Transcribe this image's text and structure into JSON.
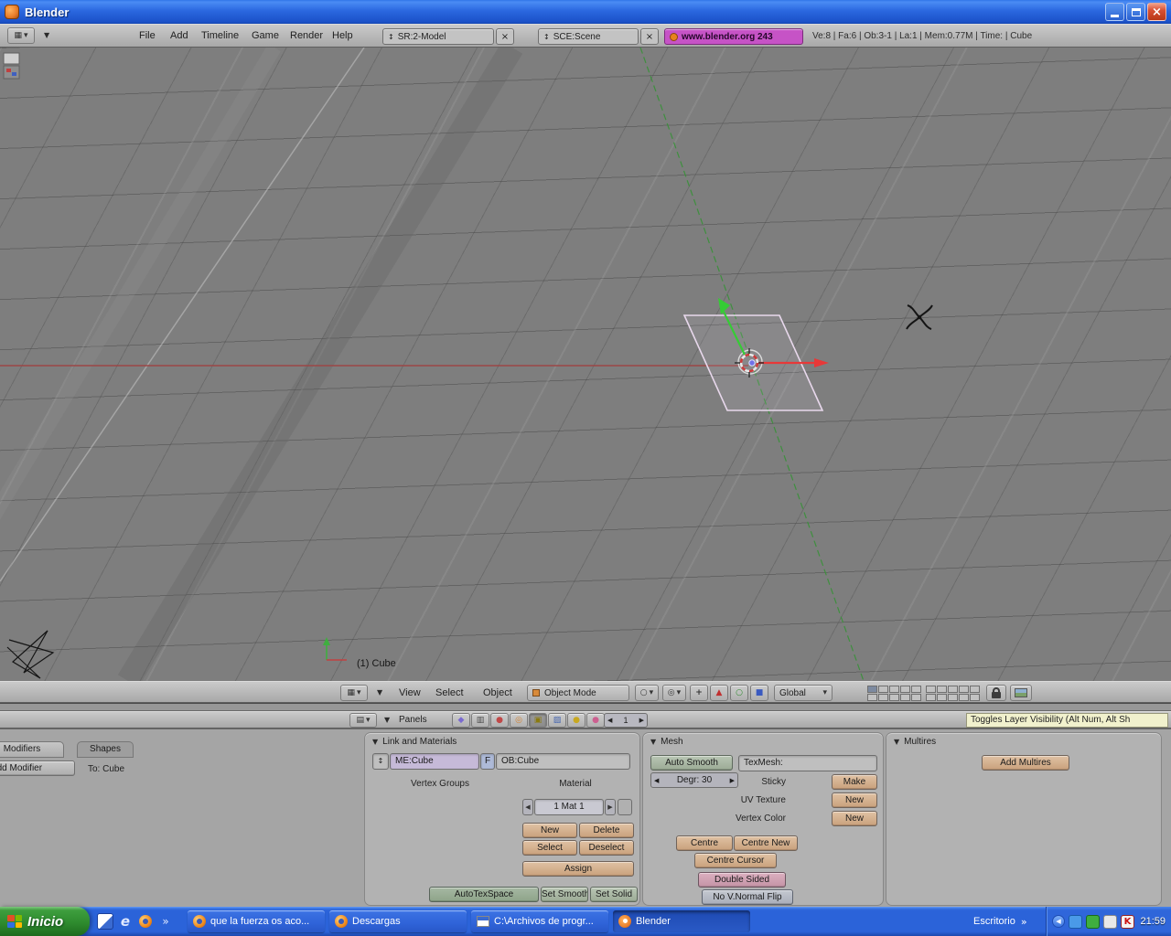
{
  "window": {
    "title": "Blender"
  },
  "icons": {
    "grid": "▦",
    "list": "▤",
    "down": "▾",
    "tri": "▼",
    "x": "×",
    "updown": "↕",
    "left": "◀",
    "right": "▶",
    "chev": "»",
    "dot": "●",
    "circle": "○",
    "square": "■",
    "triangle": "▲",
    "bullseye": "◎",
    "boxdot": "▣",
    "hlines": "▥",
    "diag": "▨",
    "diamond": "◆",
    "plus": "+",
    "e": "e",
    "K": "K"
  },
  "info_header": {
    "menus": [
      "File",
      "Add",
      "Timeline",
      "Game",
      "Render",
      "Help"
    ],
    "screen": "SR:2-Model",
    "scene": "SCE:Scene",
    "banner": "www.blender.org 243",
    "stats": "Ve:8 | Fa:6 | Ob:3-1 | La:1 | Mem:0.77M | Time: | Cube"
  },
  "viewport": {
    "active_object_label": "(1) Cube"
  },
  "viewport_header": {
    "menus": [
      "View",
      "Select",
      "Object"
    ],
    "mode": "Object Mode",
    "orientation": "Global"
  },
  "buttons_header": {
    "panels": "Panels",
    "frame": "1",
    "tooltip": "Toggles Layer Visibility (Alt Num, Alt Sh"
  },
  "editing": {
    "modifiers": {
      "tab1": "Modifiers",
      "tab2": "Shapes",
      "add": "Add Modifier",
      "to": "To: Cube"
    },
    "link_materials": {
      "title": "Link and Materials",
      "me": "ME:Cube",
      "f": "F",
      "ob": "OB:Cube",
      "vertex_groups": "Vertex Groups",
      "material": "Material",
      "mat_index": "1 Mat 1",
      "new": "New",
      "delete": "Delete",
      "select": "Select",
      "deselect": "Deselect",
      "assign": "Assign",
      "autotexspace": "AutoTexSpace",
      "set_smooth": "Set Smooth",
      "set_solid": "Set Solid"
    },
    "mesh": {
      "title": "Mesh",
      "auto_smooth": "Auto Smooth",
      "texmesh": "TexMesh:",
      "degr": "Degr: 30",
      "sticky": "Sticky",
      "make": "Make",
      "uv_texture": "UV Texture",
      "uv_new": "New",
      "vertex_color": "Vertex Color",
      "vc_new": "New",
      "centre": "Centre",
      "centre_new": "Centre New",
      "centre_cursor": "Centre Cursor",
      "double_sided": "Double Sided",
      "no_vnormal": "No V.Normal Flip"
    },
    "multires": {
      "title": "Multires",
      "add": "Add Multires"
    }
  },
  "taskbar": {
    "start": "Inicio",
    "tasks": [
      "que la fuerza os aco...",
      "Descargas",
      "C:\\Archivos de progr...",
      "Blender"
    ],
    "toolbar": "Escritorio",
    "clock": "21:59"
  },
  "colors": {
    "banner_magenta": "#c653c6",
    "button_tan": "#d2a886",
    "toggle_green": "#a9bca6",
    "toggle_pink": "#d0a2b4",
    "viewport_gray": "#7e7e7e",
    "taskbar_blue": "#2b63d9",
    "start_green": "#2e8b2e",
    "titlebar_blue": "#2b68e0"
  }
}
